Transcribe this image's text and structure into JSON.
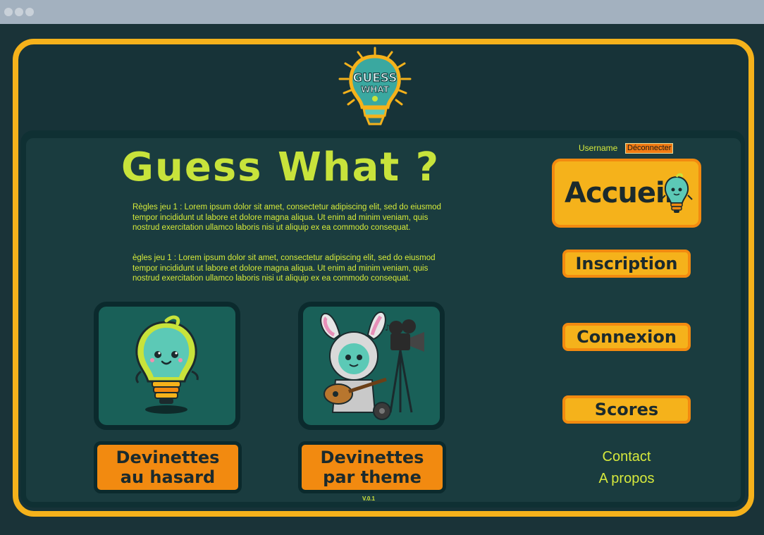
{
  "browser": {
    "controls": [
      "close-dot",
      "minimize-dot",
      "maximize-dot"
    ]
  },
  "logo": {
    "text_top": "GUESS",
    "text_bottom": "WHAT"
  },
  "header": {
    "title": "Guess What ?"
  },
  "rules": [
    "Règles jeu 1 : Lorem ipsum dolor sit amet, consectetur adipiscing elit, sed do eiusmod tempor incididunt ut labore et dolore magna aliqua. Ut enim ad minim veniam, quis nostrud exercitation ullamco laboris nisi ut aliquip ex ea commodo consequat.",
    "ègles jeu 1 : Lorem ipsum dolor sit amet, consectetur adipiscing elit, sed do eiusmod tempor incididunt ut labore et dolore magna aliqua. Ut enim ad minim veniam, quis nostrud exercitation ullamco laboris nisi ut aliquip ex ea commodo consequat."
  ],
  "games": [
    {
      "line1": "Devinettes",
      "line2": "au hasard",
      "image": "lightbulb-mascot"
    },
    {
      "line1": "Devinettes",
      "line2": "par theme",
      "image": "bunny-mascot-with-camera-and-guitar"
    }
  ],
  "user": {
    "username": "Username",
    "logout_label": "Déconnecter"
  },
  "nav": {
    "home_label": "Accueil",
    "items": [
      "Inscription",
      "Connexion",
      "Scores"
    ]
  },
  "links": [
    "Contact",
    "A propos"
  ],
  "version": "V.0.1",
  "colors": {
    "background": "#1a3338",
    "frame": "#f5b21b",
    "accent_orange": "#f28a10",
    "title_green": "#c8e33b",
    "panel": "#1a3c3f",
    "card": "#196058"
  }
}
